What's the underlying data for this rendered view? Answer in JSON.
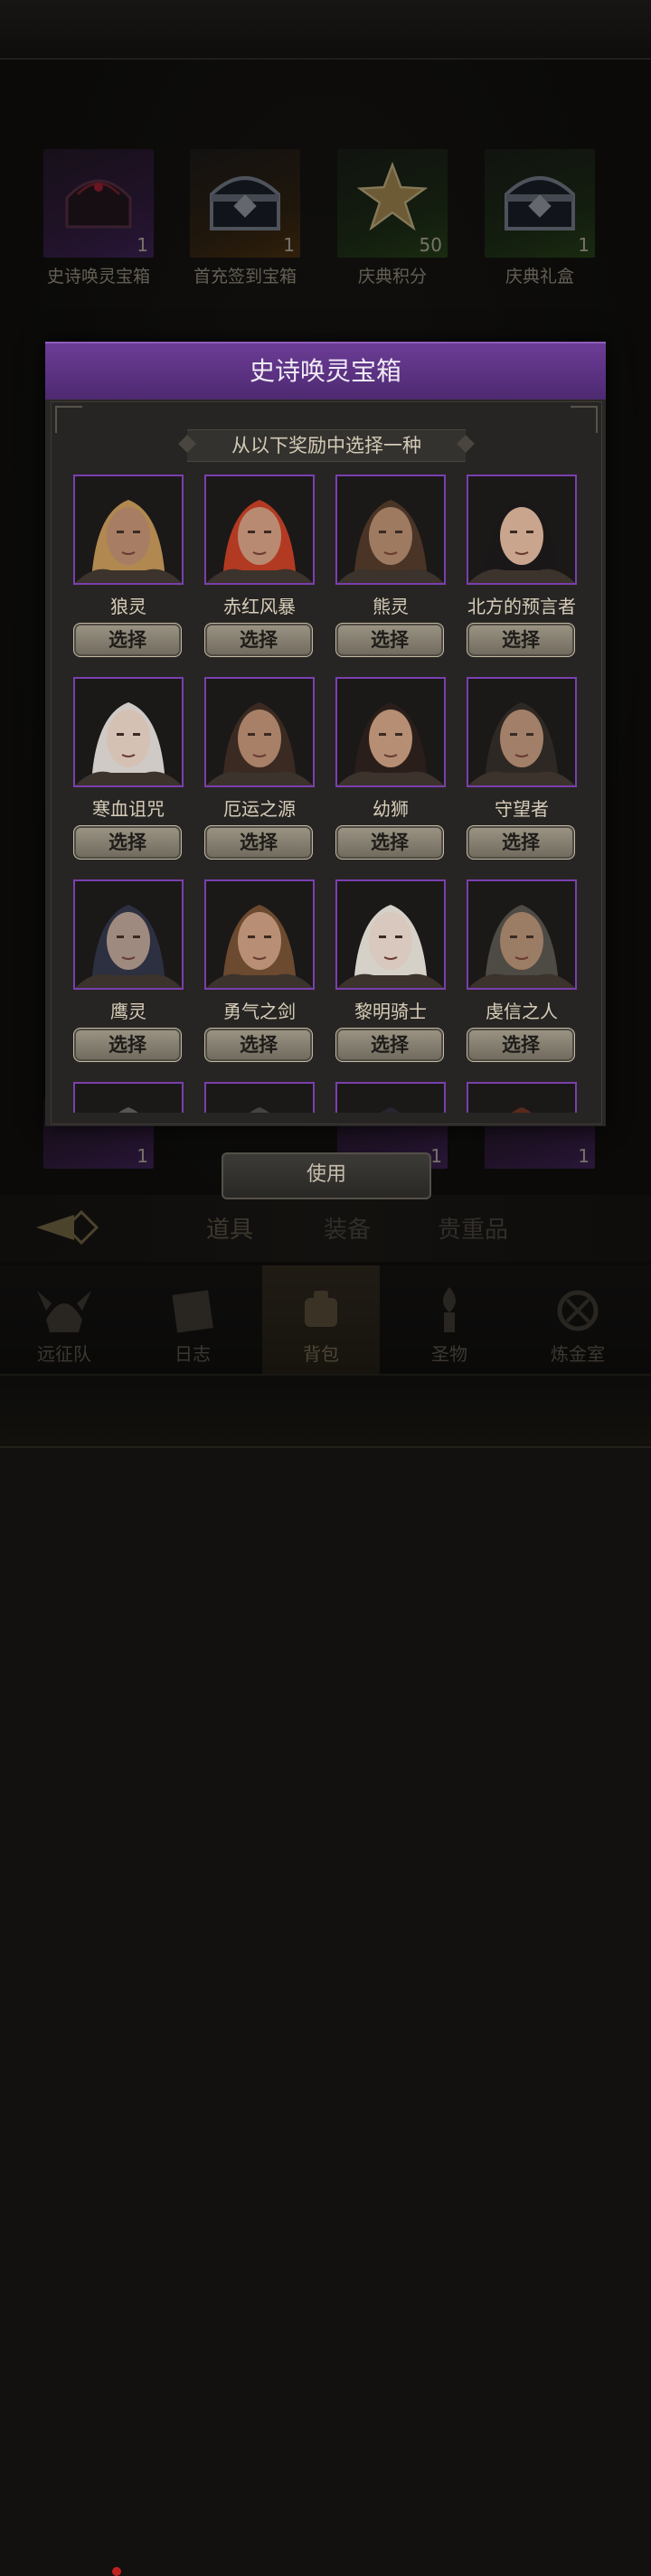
{
  "inventory_top": [
    {
      "name": "史诗唤灵宝箱",
      "count": "1",
      "quality": "purple",
      "icon": "epic-summon-chest"
    },
    {
      "name": "首充签到宝箱",
      "count": "1",
      "quality": "orange",
      "icon": "iron-chest"
    },
    {
      "name": "庆典积分",
      "count": "50",
      "quality": "green",
      "icon": "gold-star"
    },
    {
      "name": "庆典礼盒",
      "count": "1",
      "quality": "green",
      "icon": "iron-chest"
    }
  ],
  "inventory_bottom": [
    {
      "count": "1"
    },
    {
      "count": "1"
    },
    {
      "count": "1"
    }
  ],
  "use_button": "使用",
  "tabs": [
    "道具",
    "装备",
    "贵重品"
  ],
  "active_tab": "道具",
  "nav": [
    {
      "label": "远征队",
      "icon": "viking-helmet-icon"
    },
    {
      "label": "日志",
      "icon": "scroll-icon"
    },
    {
      "label": "背包",
      "icon": "backpack-icon"
    },
    {
      "label": "圣物",
      "icon": "torch-icon"
    },
    {
      "label": "炼金室",
      "icon": "alchemy-icon"
    }
  ],
  "active_nav": "背包",
  "modal": {
    "title": "史诗唤灵宝箱",
    "subtitle": "从以下奖励中选择一种",
    "select_label": "选择",
    "heroes": [
      {
        "name": "狼灵"
      },
      {
        "name": "赤红风暴"
      },
      {
        "name": "熊灵"
      },
      {
        "name": "北方的预言者"
      },
      {
        "name": "寒血诅咒"
      },
      {
        "name": "厄运之源"
      },
      {
        "name": "幼狮"
      },
      {
        "name": "守望者"
      },
      {
        "name": "鹰灵"
      },
      {
        "name": "勇气之剑"
      },
      {
        "name": "黎明骑士"
      },
      {
        "name": "虔信之人"
      },
      {
        "name": ""
      },
      {
        "name": ""
      },
      {
        "name": ""
      },
      {
        "name": ""
      }
    ]
  },
  "colors": {
    "modal_header": "#5b3283",
    "portrait_border": "#7a3fae",
    "select_button": "#8a8373"
  }
}
